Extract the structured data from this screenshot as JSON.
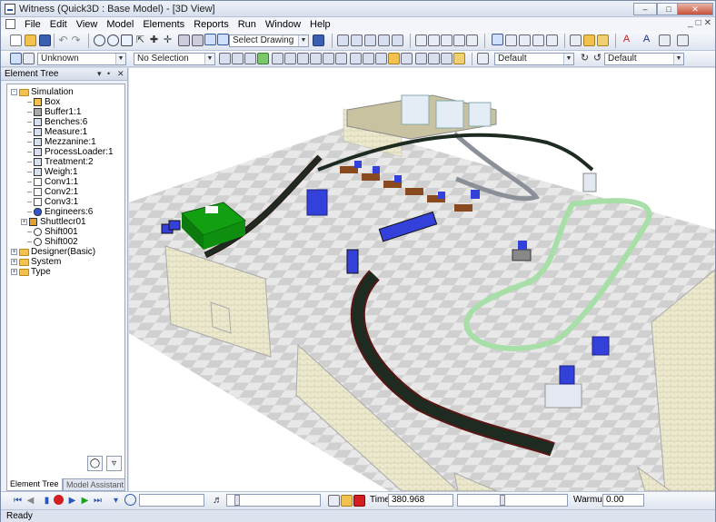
{
  "window": {
    "title": "Witness (Quick3D : Base Model) - [3D View]",
    "controls": [
      "minimize",
      "maximize",
      "close"
    ]
  },
  "menu": [
    "File",
    "Edit",
    "View",
    "Model",
    "Elements",
    "Reports",
    "Run",
    "Window",
    "Help"
  ],
  "toolbar": {
    "drawing_select": "Select Drawing",
    "unknown_select": "Unknown",
    "selection_select": "No Selection",
    "default_select_1": "Default",
    "default_select_2": "Default"
  },
  "panel": {
    "title": "Element Tree",
    "tree": [
      {
        "label": "Simulation",
        "level": 0,
        "type": "folder",
        "expander": "-"
      },
      {
        "label": "Box",
        "level": 1,
        "type": "item"
      },
      {
        "label": "Buffer1:1",
        "level": 1,
        "type": "item"
      },
      {
        "label": "Benches:6",
        "level": 1,
        "type": "item"
      },
      {
        "label": "Measure:1",
        "level": 1,
        "type": "item"
      },
      {
        "label": "Mezzanine:1",
        "level": 1,
        "type": "item"
      },
      {
        "label": "ProcessLoader:1",
        "level": 1,
        "type": "item"
      },
      {
        "label": "Treatment:2",
        "level": 1,
        "type": "item"
      },
      {
        "label": "Weigh:1",
        "level": 1,
        "type": "item"
      },
      {
        "label": "Conv1:1",
        "level": 1,
        "type": "item"
      },
      {
        "label": "Conv2:1",
        "level": 1,
        "type": "item"
      },
      {
        "label": "Conv3:1",
        "level": 1,
        "type": "item"
      },
      {
        "label": "Engineers:6",
        "level": 1,
        "type": "item"
      },
      {
        "label": "Shuttlecr01",
        "level": 1,
        "type": "item",
        "expander": "+"
      },
      {
        "label": "Shift001",
        "level": 1,
        "type": "item"
      },
      {
        "label": "Shift002",
        "level": 1,
        "type": "item"
      },
      {
        "label": "Designer(Basic)",
        "level": 0,
        "type": "folder",
        "expander": "+"
      },
      {
        "label": "System",
        "level": 0,
        "type": "folder",
        "expander": "+"
      },
      {
        "label": "Type",
        "level": 0,
        "type": "folder",
        "expander": "+"
      }
    ],
    "tabs": [
      "Element Tree",
      "Model Assistant"
    ]
  },
  "run": {
    "time_label": "Time:",
    "time_value": "380.968",
    "warmup_label": "Warmup:",
    "warmup_value": "0.00"
  },
  "status": "Ready",
  "colors": {
    "accent": "#2a55b5",
    "floor_light": "#e6e6e6",
    "floor_dark": "#d2d2d2",
    "wall": "#e8e6c8",
    "conveyor": "#1e2b20",
    "box": "#3340d9",
    "track": "#a8dfa8"
  }
}
